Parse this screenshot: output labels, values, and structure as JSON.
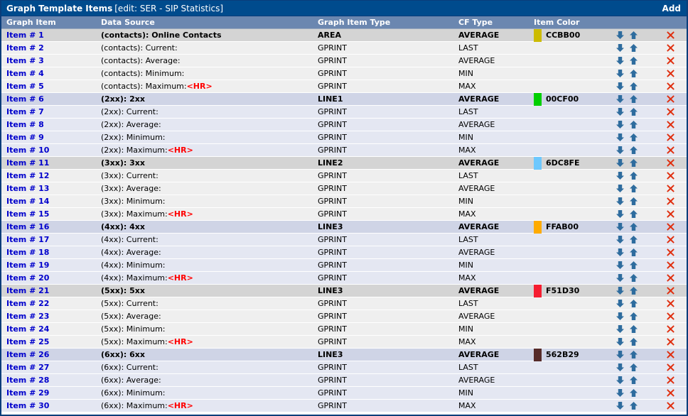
{
  "titlebar": {
    "title": "Graph Template Items",
    "subtitle": "[edit: SER - SIP Statistics]",
    "add_label": "Add"
  },
  "colors": {
    "titlebar_bg": "#004B8D",
    "colheader_bg": "#6B87B0",
    "link": "#0000CC",
    "hr_tag": "#FF0000",
    "arrow": "#2E6C9E",
    "delete": "#E03010",
    "row_alt_a": "#EFEFEF",
    "row_alt_b": "#E4E7F2",
    "row_hdr_a": "#D4D4D4",
    "row_hdr_b": "#CFD4E6"
  },
  "columns": [
    {
      "key": "graph_item",
      "label": "Graph Item"
    },
    {
      "key": "data_source",
      "label": "Data Source"
    },
    {
      "key": "graph_item_type",
      "label": "Graph Item Type"
    },
    {
      "key": "cf_type",
      "label": "CF Type"
    },
    {
      "key": "item_color",
      "label": "Item Color"
    }
  ],
  "icons": {
    "move_down": "arrow-down-icon",
    "move_up": "arrow-up-icon",
    "delete": "delete-x-icon"
  },
  "rows": [
    {
      "item": "Item # 1",
      "ds": "(contacts): Online Contacts",
      "hr": false,
      "git": "AREA",
      "cf": "AVERAGE",
      "color_hex": "CCBB00",
      "color_value": "#CCBB00",
      "style": "hdr-a"
    },
    {
      "item": "Item # 2",
      "ds": "(contacts): Current:",
      "hr": false,
      "git": "GPRINT",
      "cf": "LAST",
      "color_hex": "",
      "color_value": "",
      "style": "alt-a"
    },
    {
      "item": "Item # 3",
      "ds": "(contacts): Average:",
      "hr": false,
      "git": "GPRINT",
      "cf": "AVERAGE",
      "color_hex": "",
      "color_value": "",
      "style": "alt-a"
    },
    {
      "item": "Item # 4",
      "ds": "(contacts): Minimum:",
      "hr": false,
      "git": "GPRINT",
      "cf": "MIN",
      "color_hex": "",
      "color_value": "",
      "style": "alt-a"
    },
    {
      "item": "Item # 5",
      "ds": "(contacts): Maximum:",
      "hr": true,
      "git": "GPRINT",
      "cf": "MAX",
      "color_hex": "",
      "color_value": "",
      "style": "alt-a"
    },
    {
      "item": "Item # 6",
      "ds": "(2xx): 2xx",
      "hr": false,
      "git": "LINE1",
      "cf": "AVERAGE",
      "color_hex": "00CF00",
      "color_value": "#00CF00",
      "style": "hdr-b"
    },
    {
      "item": "Item # 7",
      "ds": "(2xx): Current:",
      "hr": false,
      "git": "GPRINT",
      "cf": "LAST",
      "color_hex": "",
      "color_value": "",
      "style": "alt-b"
    },
    {
      "item": "Item # 8",
      "ds": "(2xx): Average:",
      "hr": false,
      "git": "GPRINT",
      "cf": "AVERAGE",
      "color_hex": "",
      "color_value": "",
      "style": "alt-b"
    },
    {
      "item": "Item # 9",
      "ds": "(2xx): Minimum:",
      "hr": false,
      "git": "GPRINT",
      "cf": "MIN",
      "color_hex": "",
      "color_value": "",
      "style": "alt-b"
    },
    {
      "item": "Item # 10",
      "ds": "(2xx): Maximum:",
      "hr": true,
      "git": "GPRINT",
      "cf": "MAX",
      "color_hex": "",
      "color_value": "",
      "style": "alt-b"
    },
    {
      "item": "Item # 11",
      "ds": "(3xx): 3xx",
      "hr": false,
      "git": "LINE2",
      "cf": "AVERAGE",
      "color_hex": "6DC8FE",
      "color_value": "#6DC8FE",
      "style": "hdr-a"
    },
    {
      "item": "Item # 12",
      "ds": "(3xx): Current:",
      "hr": false,
      "git": "GPRINT",
      "cf": "LAST",
      "color_hex": "",
      "color_value": "",
      "style": "alt-a"
    },
    {
      "item": "Item # 13",
      "ds": "(3xx): Average:",
      "hr": false,
      "git": "GPRINT",
      "cf": "AVERAGE",
      "color_hex": "",
      "color_value": "",
      "style": "alt-a"
    },
    {
      "item": "Item # 14",
      "ds": "(3xx): Minimum:",
      "hr": false,
      "git": "GPRINT",
      "cf": "MIN",
      "color_hex": "",
      "color_value": "",
      "style": "alt-a"
    },
    {
      "item": "Item # 15",
      "ds": "(3xx): Maximum:",
      "hr": true,
      "git": "GPRINT",
      "cf": "MAX",
      "color_hex": "",
      "color_value": "",
      "style": "alt-a"
    },
    {
      "item": "Item # 16",
      "ds": "(4xx): 4xx",
      "hr": false,
      "git": "LINE3",
      "cf": "AVERAGE",
      "color_hex": "FFAB00",
      "color_value": "#FFAB00",
      "style": "hdr-b"
    },
    {
      "item": "Item # 17",
      "ds": "(4xx): Current:",
      "hr": false,
      "git": "GPRINT",
      "cf": "LAST",
      "color_hex": "",
      "color_value": "",
      "style": "alt-b"
    },
    {
      "item": "Item # 18",
      "ds": "(4xx): Average:",
      "hr": false,
      "git": "GPRINT",
      "cf": "AVERAGE",
      "color_hex": "",
      "color_value": "",
      "style": "alt-b"
    },
    {
      "item": "Item # 19",
      "ds": "(4xx): Minimum:",
      "hr": false,
      "git": "GPRINT",
      "cf": "MIN",
      "color_hex": "",
      "color_value": "",
      "style": "alt-b"
    },
    {
      "item": "Item # 20",
      "ds": "(4xx): Maximum:",
      "hr": true,
      "git": "GPRINT",
      "cf": "MAX",
      "color_hex": "",
      "color_value": "",
      "style": "alt-b"
    },
    {
      "item": "Item # 21",
      "ds": "(5xx): 5xx",
      "hr": false,
      "git": "LINE3",
      "cf": "AVERAGE",
      "color_hex": "F51D30",
      "color_value": "#F51D30",
      "style": "hdr-a"
    },
    {
      "item": "Item # 22",
      "ds": "(5xx): Current:",
      "hr": false,
      "git": "GPRINT",
      "cf": "LAST",
      "color_hex": "",
      "color_value": "",
      "style": "alt-a"
    },
    {
      "item": "Item # 23",
      "ds": "(5xx): Average:",
      "hr": false,
      "git": "GPRINT",
      "cf": "AVERAGE",
      "color_hex": "",
      "color_value": "",
      "style": "alt-a"
    },
    {
      "item": "Item # 24",
      "ds": "(5xx): Minimum:",
      "hr": false,
      "git": "GPRINT",
      "cf": "MIN",
      "color_hex": "",
      "color_value": "",
      "style": "alt-a"
    },
    {
      "item": "Item # 25",
      "ds": "(5xx): Maximum:",
      "hr": true,
      "git": "GPRINT",
      "cf": "MAX",
      "color_hex": "",
      "color_value": "",
      "style": "alt-a"
    },
    {
      "item": "Item # 26",
      "ds": "(6xx): 6xx",
      "hr": false,
      "git": "LINE3",
      "cf": "AVERAGE",
      "color_hex": "562B29",
      "color_value": "#562B29",
      "style": "hdr-b"
    },
    {
      "item": "Item # 27",
      "ds": "(6xx): Current:",
      "hr": false,
      "git": "GPRINT",
      "cf": "LAST",
      "color_hex": "",
      "color_value": "",
      "style": "alt-b"
    },
    {
      "item": "Item # 28",
      "ds": "(6xx): Average:",
      "hr": false,
      "git": "GPRINT",
      "cf": "AVERAGE",
      "color_hex": "",
      "color_value": "",
      "style": "alt-b"
    },
    {
      "item": "Item # 29",
      "ds": "(6xx): Minimum:",
      "hr": false,
      "git": "GPRINT",
      "cf": "MIN",
      "color_hex": "",
      "color_value": "",
      "style": "alt-b"
    },
    {
      "item": "Item # 30",
      "ds": "(6xx): Maximum:",
      "hr": true,
      "git": "GPRINT",
      "cf": "MAX",
      "color_hex": "",
      "color_value": "",
      "style": "alt-b"
    }
  ]
}
